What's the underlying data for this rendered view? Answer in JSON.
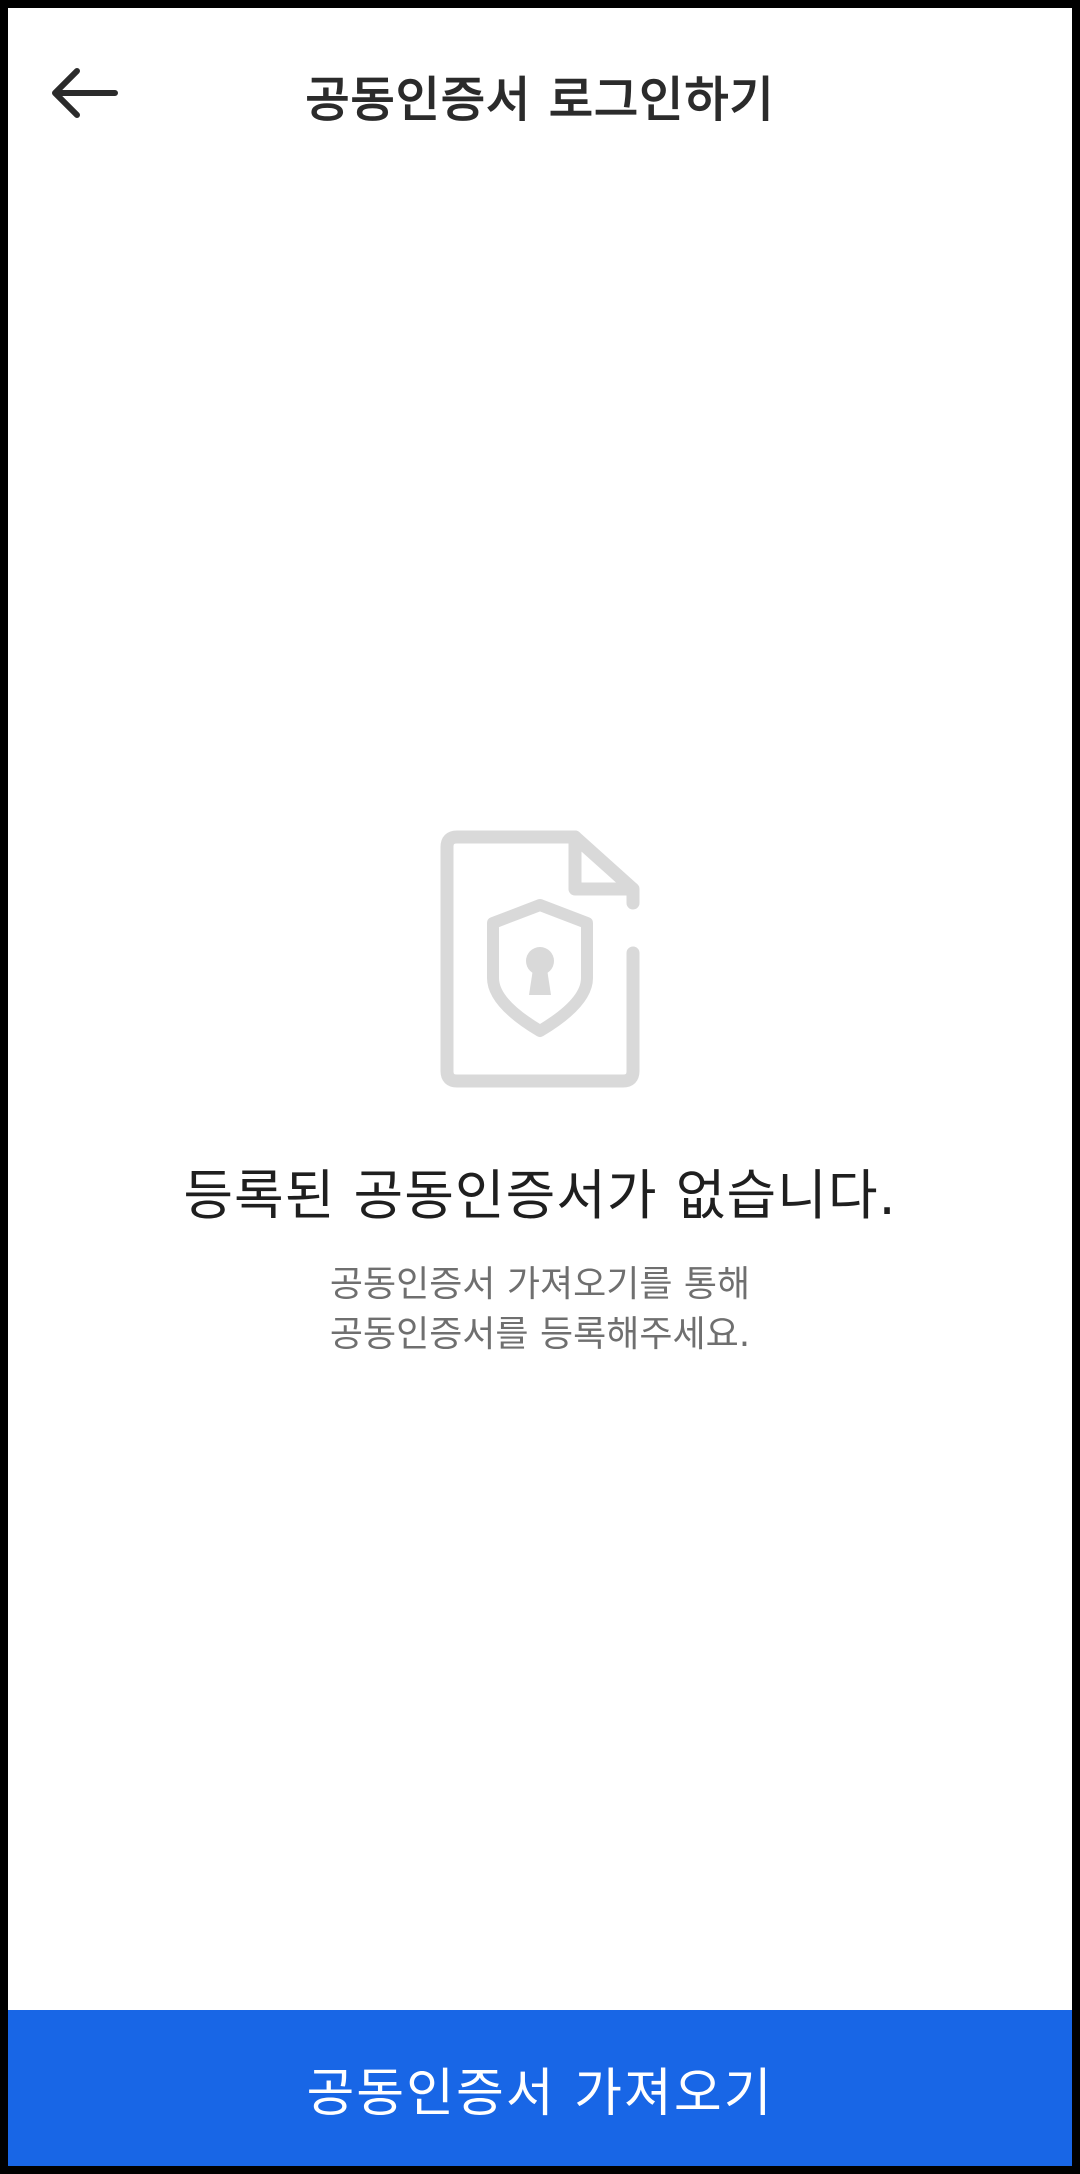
{
  "header": {
    "back_icon": "arrow-left-icon",
    "title": "공동인증서 로그인하기"
  },
  "empty_state": {
    "icon": "certificate-lock-icon",
    "title": "등록된 공동인증서가 없습니다.",
    "description_line1": "공동인증서 가져오기를 통해",
    "description_line2": "공동인증서를 등록해주세요."
  },
  "footer": {
    "import_label": "공동인증서 가져오기"
  },
  "colors": {
    "accent": "#1866e6",
    "icon_gray": "#d9d9d9",
    "title_text": "#2b2b2b",
    "secondary_text": "#6f6f6f"
  }
}
